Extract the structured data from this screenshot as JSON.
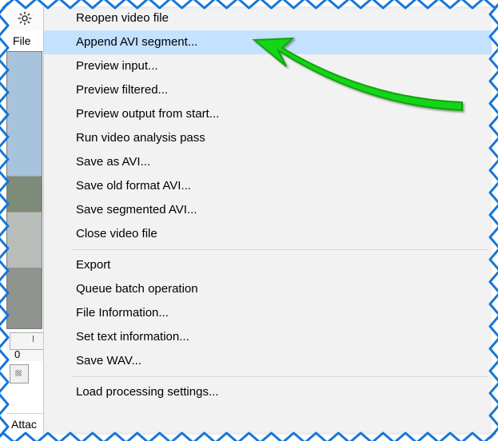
{
  "titlebar": {
    "icon": "gear-icon"
  },
  "menubar": {
    "file_label": "File"
  },
  "timeline": {
    "pos_label": "0"
  },
  "bottom": {
    "label": "Attac"
  },
  "menu": {
    "group1": [
      "Reopen video file",
      "Append AVI segment...",
      "Preview input...",
      "Preview filtered...",
      "Preview output from start...",
      "Run video analysis pass",
      "Save as AVI...",
      "Save old format AVI...",
      "Save segmented AVI...",
      "Close video file"
    ],
    "group2": [
      "Export",
      "Queue batch operation",
      "File Information...",
      "Set text information...",
      "Save WAV..."
    ],
    "group3": [
      "Load processing settings..."
    ],
    "highlight_index": 1
  }
}
